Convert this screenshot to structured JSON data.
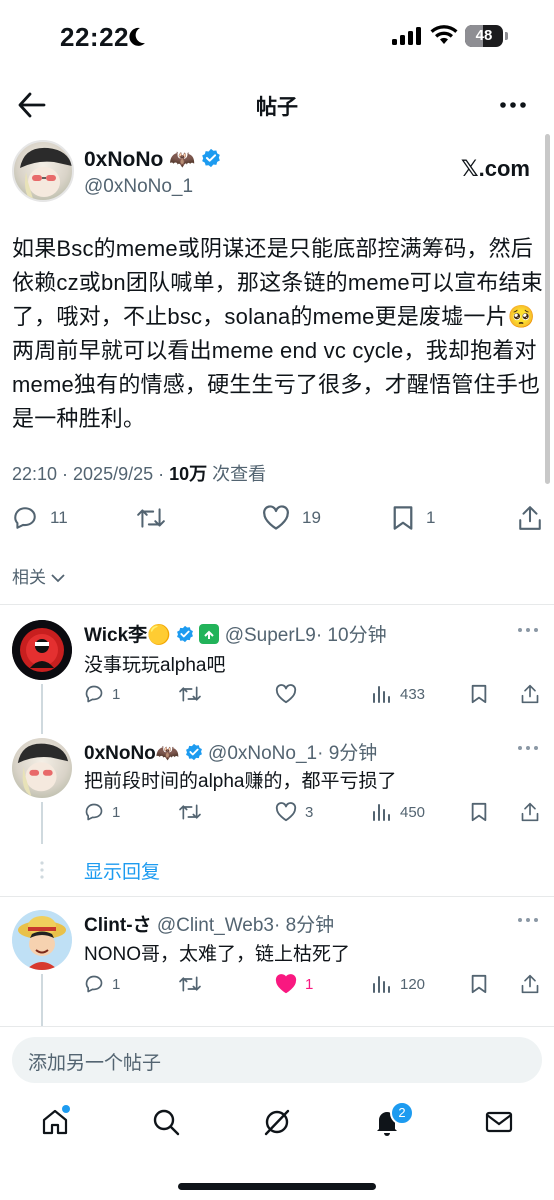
{
  "status_bar": {
    "time": "22:22",
    "battery": "48",
    "battery_level": 0.48
  },
  "nav": {
    "title": "帖子"
  },
  "post": {
    "author_name": "0xNoNo",
    "author_emoji": "🦇",
    "handle": "@0xNoNo_1",
    "source_label": "𝕏.com",
    "text": "如果Bsc的meme或阴谋还是只能底部控满筹码，然后依赖cz或bn团队喊单，那这条链的meme可以宣布结束了，哦对，不止bsc，solana的meme更是废墟一片🥺两周前早就可以看出meme end vc cycle，我却抱着对meme独有的情感，硬生生亏了很多，才醒悟管住手也是一种胜利。",
    "time": "22:10 · 2025/9/25 · ",
    "views": "10万",
    "views_label": " 次查看",
    "replies": "11",
    "retweets": "",
    "likes": "19",
    "bookmarks": "1"
  },
  "related_label": "相关",
  "replies": [
    {
      "name": "Wick李",
      "emoji": "🟡",
      "handle": "@SuperL9",
      "time": "· 10分钟",
      "text": "没事玩玩alpha吧",
      "replies": "1",
      "retweets": "",
      "likes": "",
      "views": "433"
    },
    {
      "name": "0xNoNo",
      "emoji": "🦇",
      "handle": "@0xNoNo_1",
      "time": "· 9分钟",
      "text": "把前段时间的alpha赚的，都平亏损了",
      "replies": "1",
      "retweets": "",
      "likes": "3",
      "views": "450"
    },
    {
      "name": "Clint-さ",
      "emoji": "",
      "handle": "@Clint_Web3",
      "time": "· 8分钟",
      "text": "NONO哥，太难了，链上枯死了",
      "replies": "1",
      "retweets": "",
      "likes": "1",
      "views": "120"
    }
  ],
  "show_replies": "显示回复",
  "composer_placeholder": "添加另一个帖子",
  "tab_bar": {
    "notifications_badge": "2"
  },
  "colors": {
    "accent": "#1d9bf0",
    "like_active": "#f91880",
    "secondary": "#536471"
  }
}
